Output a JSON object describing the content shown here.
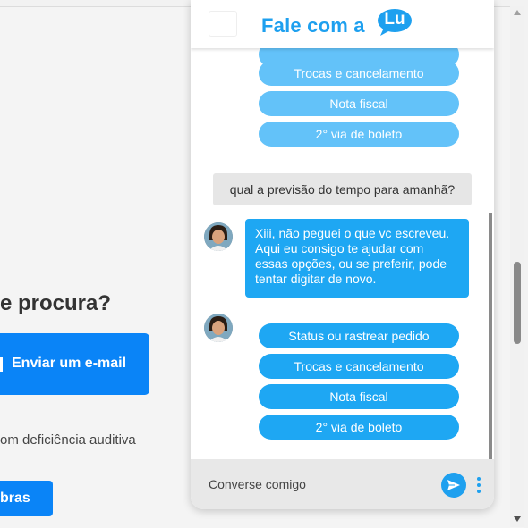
{
  "page": {
    "heading": "e procura?",
    "email_button": "Enviar um e-mail",
    "deficiencia_text": "om deficiência auditiva",
    "libras_button": "bras"
  },
  "chat": {
    "header": {
      "title": "Fale com a",
      "badge": "Lu"
    },
    "options_first": [
      "Trocas e cancelamento",
      "Nota fiscal",
      "2° via de boleto"
    ],
    "user_message": "qual a previsão do tempo para amanhã?",
    "bot_message": [
      "Xiii, não peguei o que vc escreveu.",
      "Aqui eu consigo te ajudar com",
      "essas opções, ou se preferir, pode",
      "tentar digitar de novo."
    ],
    "options_second": [
      "Status ou rastrear pedido",
      "Trocas e cancelamento",
      "Nota fiscal",
      "2° via de boleto"
    ],
    "input_placeholder": "Converse comigo"
  },
  "icons": {
    "send": "send-icon",
    "menu": "more-vertical-icon",
    "avatar": "lu-avatar",
    "scroll_up": "chevron-up-icon",
    "scroll_down": "chevron-down-icon"
  },
  "colors": {
    "accent": "#1ea0ef",
    "option_light": "#63c2f9",
    "option_dark": "#1ea7f3",
    "page_button": "#0a84f7"
  }
}
